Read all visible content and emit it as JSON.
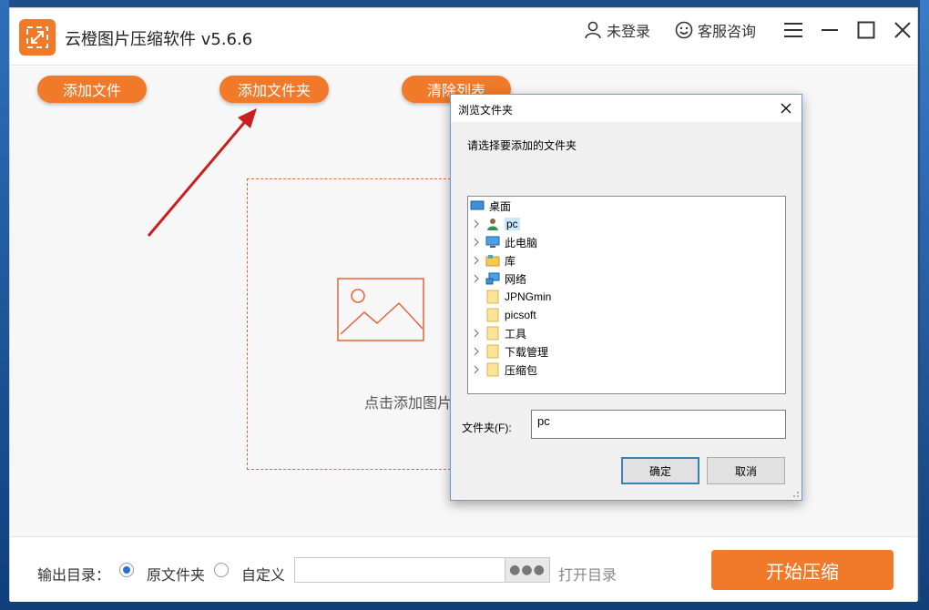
{
  "app": {
    "title": "云橙图片压缩软件 v5.6.6",
    "login_label": "未登录",
    "support_label": "客服咨询",
    "accent_color": "#f07a2a"
  },
  "toolbar": {
    "add_file": "添加文件",
    "add_folder": "添加文件夹",
    "clear_list": "清除列表"
  },
  "dropzone": {
    "text": "点击添加图片"
  },
  "footer": {
    "output_label": "输出目录：",
    "option_original": "原文件夹",
    "option_custom": "自定义",
    "custom_path_value": "",
    "browse_label": "●●●",
    "open_dir": "打开目录",
    "start": "开始压缩"
  },
  "dialog": {
    "title": "浏览文件夹",
    "prompt": "请选择要添加的文件夹",
    "tree": [
      {
        "label": "桌面",
        "icon": "desktop-icon",
        "expandable": false
      },
      {
        "label": "pc",
        "icon": "user-icon",
        "expandable": true,
        "selected": true
      },
      {
        "label": "此电脑",
        "icon": "computer-icon",
        "expandable": true
      },
      {
        "label": "库",
        "icon": "library-icon",
        "expandable": true
      },
      {
        "label": "网络",
        "icon": "network-icon",
        "expandable": true
      },
      {
        "label": "JPNGmin",
        "icon": "folder-icon",
        "expandable": false
      },
      {
        "label": "picsoft",
        "icon": "folder-icon",
        "expandable": false
      },
      {
        "label": "工具",
        "icon": "folder-icon",
        "expandable": true
      },
      {
        "label": "下载管理",
        "icon": "folder-icon",
        "expandable": true
      },
      {
        "label": "压缩包",
        "icon": "folder-icon",
        "expandable": true
      }
    ],
    "folder_label": "文件夹(F):",
    "folder_value": "pc",
    "ok": "确定",
    "cancel": "取消"
  }
}
